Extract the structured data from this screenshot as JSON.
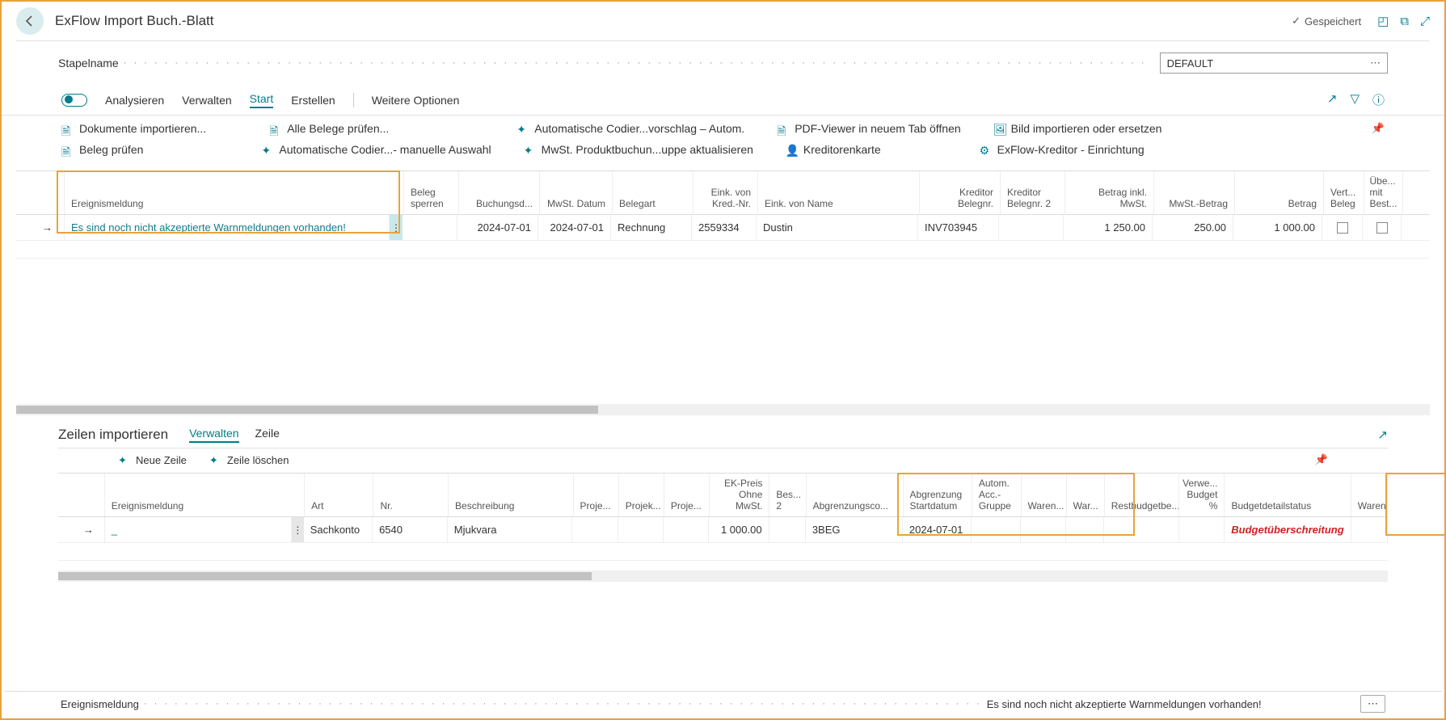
{
  "header": {
    "title": "ExFlow Import Buch.-Blatt",
    "saved": "Gespeichert"
  },
  "field": {
    "label": "Stapelname",
    "value": "DEFAULT"
  },
  "toolbar": {
    "analyze": "Analysieren",
    "manage": "Verwalten",
    "start": "Start",
    "create": "Erstellen",
    "more": "Weitere Optionen"
  },
  "actions": {
    "importDocs": "Dokumente importieren...",
    "checkAll": "Alle Belege prüfen...",
    "autoCoding": "Automatische Codier...vorschlag – Autom.",
    "pdfViewer": "PDF-Viewer in neuem Tab öffnen",
    "importImage": "Bild importieren oder ersetzen",
    "checkDoc": "Beleg prüfen",
    "autoCodingManual": "Automatische Codier...- manuelle Auswahl",
    "vatGroup": "MwSt. Produktbuchun...uppe aktualisieren",
    "vendorCard": "Kreditorenkarte",
    "exflowVendor": "ExFlow-Kreditor - Einrichtung"
  },
  "grid1": {
    "cols": {
      "event": "Ereignismeldung",
      "lockDoc": "Beleg sperren",
      "postingDate": "Buchungsd...",
      "vatDate": "MwSt. Datum",
      "docType": "Belegart",
      "vendorNo": "Eink. von Kred.-Nr.",
      "vendorName": "Eink. von Name",
      "vendorDocNo": "Kreditor Belegnr.",
      "vendorDocNo2": "Kreditor Belegnr. 2",
      "amtIncl": "Betrag inkl. MwSt.",
      "vatAmt": "MwSt.-Betrag",
      "amount": "Betrag",
      "confDoc": "Vert... Beleg",
      "withOrder": "Übe... mit Best..."
    },
    "row": {
      "event": "Es sind noch nicht akzeptierte Warnmeldungen vorhanden!",
      "postingDate": "2024-07-01",
      "vatDate": "2024-07-01",
      "docType": "Rechnung",
      "vendorNo": "2559334",
      "vendorName": "Dustin",
      "vendorDocNo": "INV703945",
      "amtIncl": "1 250.00",
      "vatAmt": "250.00",
      "amount": "1 000.00"
    }
  },
  "sub": {
    "title": "Zeilen importieren",
    "manage": "Verwalten",
    "line": "Zeile",
    "newLine": "Neue Zeile",
    "deleteLine": "Zeile löschen"
  },
  "grid2": {
    "cols": {
      "event": "Ereignismeldung",
      "type": "Art",
      "no": "Nr.",
      "desc": "Beschreibung",
      "proj1": "Proje...",
      "proj2": "Projek...",
      "proj3": "Proje...",
      "unitPrice": "EK-Preis Ohne MwSt.",
      "bes": "Bes... 2",
      "deferCode": "Abgrenzungsco...",
      "deferStart": "Abgrenzung Startdatum",
      "autoAcc": "Autom. Acc.- Gruppe",
      "w1": "Waren...",
      "w2": "War...",
      "rest": "Restbudgetbe...",
      "usedPct": "Verwe... Budget %",
      "budgetStatus": "Budgetdetailstatus",
      "w3": "Waren"
    },
    "row": {
      "eventDash": "_",
      "type": "Sachkonto",
      "no": "6540",
      "desc": "Mjukvara",
      "unitPrice": "1 000.00",
      "deferCode": "3BEG",
      "deferStart": "2024-07-01",
      "wDash": "_",
      "budgetStatus": "Budgetüberschreitung"
    }
  },
  "footer": {
    "label": "Ereignismeldung",
    "value": "Es sind noch nicht akzeptierte Warnmeldungen vorhanden!"
  }
}
